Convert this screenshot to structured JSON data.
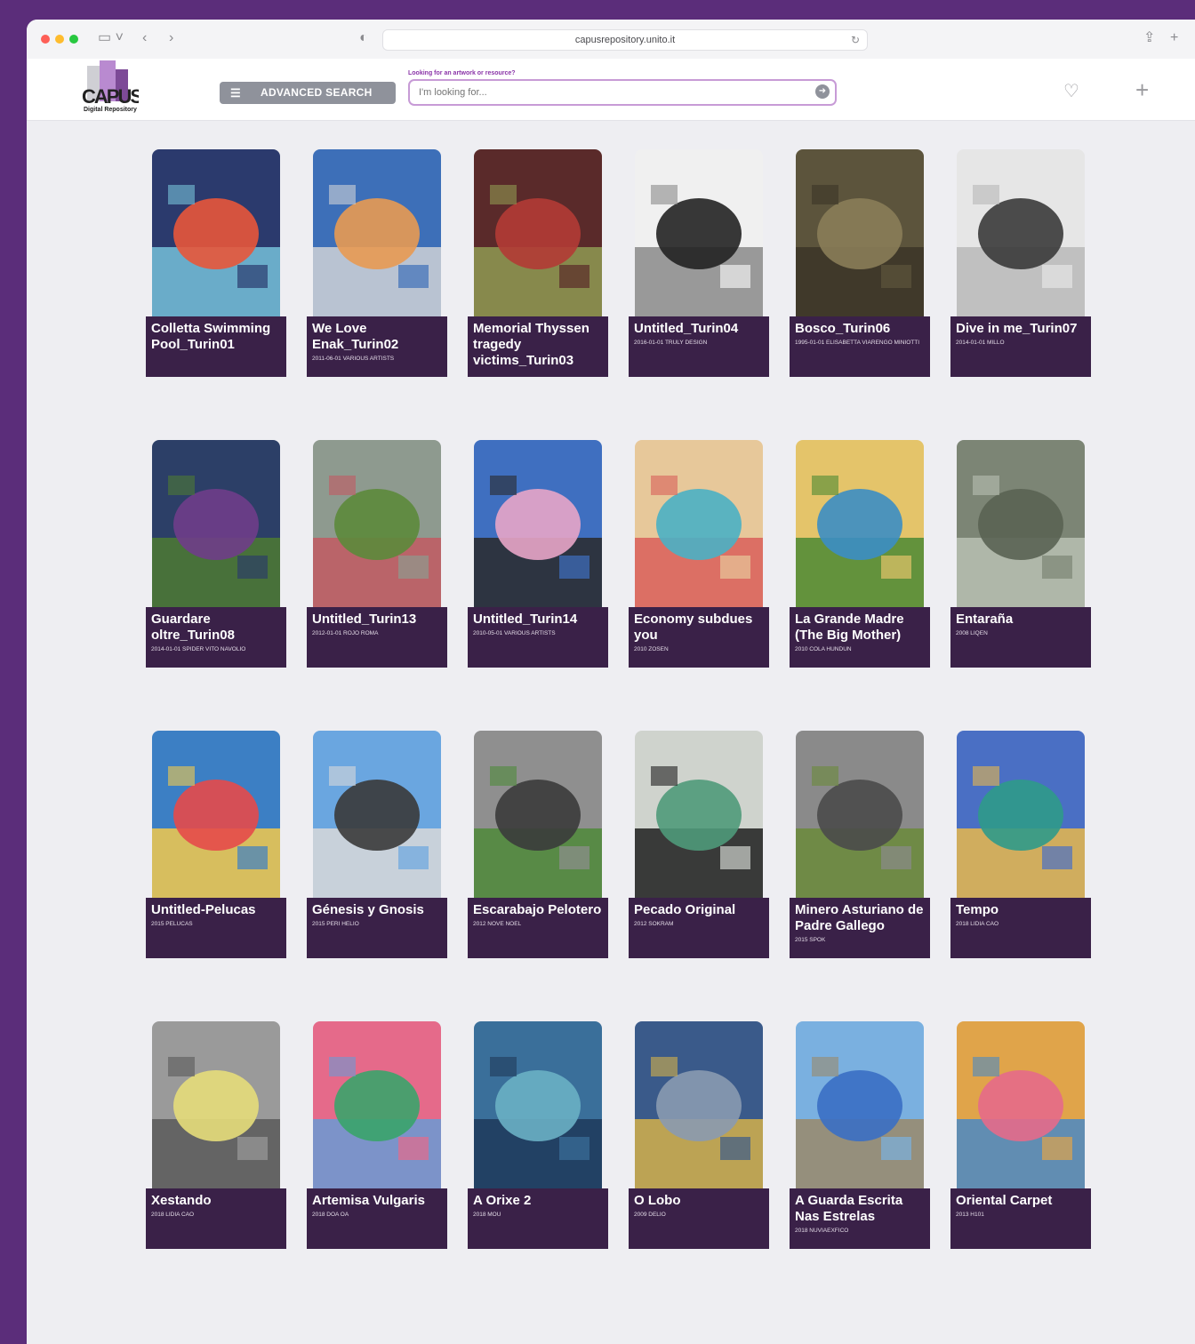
{
  "browser": {
    "url": "capusrepository.unito.it"
  },
  "header": {
    "logo_text": "CAPUS",
    "logo_subtitle": "Digital Repository",
    "advanced_search_label": "ADVANCED SEARCH",
    "search_hint": "Looking for an artwork or resource?",
    "search_placeholder": "I'm looking for..."
  },
  "artworks": [
    {
      "title": "Colletta Swimming Pool_Turin01",
      "meta": "",
      "colors": [
        "#2b3a6d",
        "#e8563a",
        "#76c1d9"
      ]
    },
    {
      "title": "We Love Enak_Turin02",
      "meta": "2011-06-01 VARIOUS ARTISTS",
      "colors": [
        "#3d6fb8",
        "#e89a52",
        "#cfd2d6"
      ]
    },
    {
      "title": "Memorial Thyssen tragedy victims_Turin03",
      "meta": "",
      "colors": [
        "#5a2a2a",
        "#b33b35",
        "#8f9a52"
      ]
    },
    {
      "title": "Untitled_Turin04",
      "meta": "2016-01-01 TRULY DESIGN",
      "colors": [
        "#f0f0f0",
        "#222222",
        "#8a8a8a"
      ]
    },
    {
      "title": "Bosco_Turin06",
      "meta": "1995-01-01 ELISABETTA VIARENGO MINIOTTI",
      "colors": [
        "#5c543c",
        "#8a7d58",
        "#3b3527"
      ]
    },
    {
      "title": "Dive in me_Turin07",
      "meta": "2014-01-01 MILLO",
      "colors": [
        "#e6e6e6",
        "#3a3a3a",
        "#b8b8b8"
      ]
    },
    {
      "title": "Guardare oltre_Turin08",
      "meta": "2014-01-01 SPIDER VITO NAVOLIO",
      "colors": [
        "#2c3f67",
        "#6f3d8a",
        "#4e7a33"
      ]
    },
    {
      "title": "Untitled_Turin13",
      "meta": "2012-01-01 ROJO ROMA",
      "colors": [
        "#8e9a8f",
        "#5c8a3b",
        "#c25a63"
      ]
    },
    {
      "title": "Untitled_Turin14",
      "meta": "2010-05-01 VARIOUS ARTISTS",
      "colors": [
        "#3f6fc0",
        "#e8a5c8",
        "#2a2a2a"
      ]
    },
    {
      "title": "Economy subdues you",
      "meta": "2010 ZOSEN",
      "colors": [
        "#e7c89a",
        "#4ab0c4",
        "#d95f5a"
      ]
    },
    {
      "title": "La Grande Madre (The Big Mother)",
      "meta": "2010 COLA HUNDUN",
      "colors": [
        "#e4c46a",
        "#3b8ec4",
        "#4c8a34"
      ]
    },
    {
      "title": "Entaraña",
      "meta": "2008 LIQEN",
      "colors": [
        "#7c8575",
        "#5a6353",
        "#b9c0b3"
      ]
    },
    {
      "title": "Untitled-Pelucas",
      "meta": "2015 PELUCAS",
      "colors": [
        "#3c7fc4",
        "#e54a4a",
        "#f2c94c"
      ]
    },
    {
      "title": "Génesis y Gnosis",
      "meta": "2015 PERI HELIO",
      "colors": [
        "#6aa6e0",
        "#3a3a3a",
        "#d8d8d8"
      ]
    },
    {
      "title": "Escarabajo Pelotero",
      "meta": "2012 NOVE NOEL",
      "colors": [
        "#8f8f8f",
        "#3b3b3b",
        "#4f8a3a"
      ]
    },
    {
      "title": "Pecado Original",
      "meta": "2012 SOKRAM",
      "colors": [
        "#cfd3cd",
        "#4f9a7a",
        "#1f1f1f"
      ]
    },
    {
      "title": "Minero Asturiano de Padre Gallego",
      "meta": "2015 SPOK",
      "colors": [
        "#8a8a8a",
        "#4a4a4a",
        "#6a8a3a"
      ]
    },
    {
      "title": "Tempo",
      "meta": "2018 LIDIA CAO",
      "colors": [
        "#4a6fc4",
        "#2f9a8a",
        "#e8b84c"
      ]
    },
    {
      "title": "Xestando",
      "meta": "2018 LIDIA CAO",
      "colors": [
        "#9a9a9a",
        "#e5dd7a",
        "#5a5a5a"
      ]
    },
    {
      "title": "Artemisa Vulgaris",
      "meta": "2018 DOA OA",
      "colors": [
        "#e56a8a",
        "#3aa46a",
        "#6a9ad4"
      ]
    },
    {
      "title": "A Orixe 2",
      "meta": "2018 MOU",
      "colors": [
        "#3a6f9a",
        "#6ab0c4",
        "#1f3a5a"
      ]
    },
    {
      "title": "O Lobo",
      "meta": "2009 DELIO",
      "colors": [
        "#3a5a8a",
        "#8a9ab0",
        "#d4b04a"
      ]
    },
    {
      "title": "A Guarda Escrita Nas Estrelas",
      "meta": "2018 NUVIAEXFICO",
      "colors": [
        "#7ab0e0",
        "#3a6fc4",
        "#9a8a6a"
      ]
    },
    {
      "title": "Oriental Carpet",
      "meta": "2013 H101",
      "colors": [
        "#e0a44a",
        "#e56a8a",
        "#4a8ac4"
      ]
    }
  ]
}
